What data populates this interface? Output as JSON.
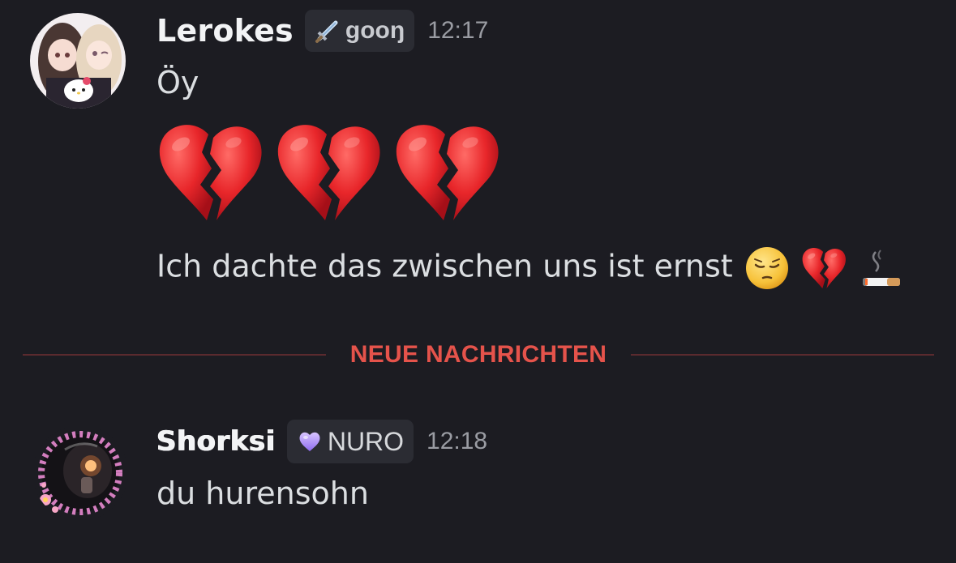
{
  "messages": [
    {
      "username": "Lerokes",
      "tag": {
        "icon": "sword-icon",
        "label": "gooŋ"
      },
      "timestamp": "12:17",
      "lines": {
        "first": "Öy",
        "big_emojis": [
          "broken-heart",
          "broken-heart",
          "broken-heart"
        ],
        "third": "Ich dachte das zwischen uns ist ernst",
        "third_emojis": [
          "pensive-face",
          "broken-heart",
          "cigarette"
        ]
      }
    },
    {
      "username": "Shorksi",
      "tag": {
        "icon": "purple-heart-icon",
        "label": "NURO"
      },
      "timestamp": "12:18",
      "lines": {
        "first": "du hurensohn"
      }
    }
  ],
  "divider": {
    "label": "NEUE NACHRICHTEN"
  },
  "colors": {
    "background": "#1c1c22",
    "divider_text": "#e5534b",
    "divider_line": "#5a2a2e",
    "tag_background": "#2b2c33",
    "timestamp": "#9a9ca3"
  }
}
